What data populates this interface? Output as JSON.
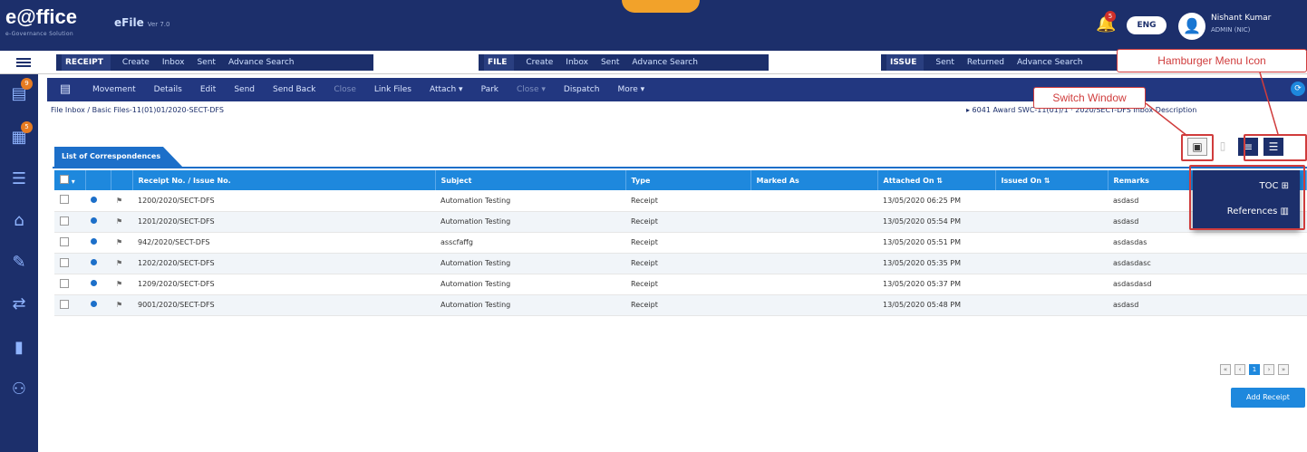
{
  "header": {
    "logo": "e@ffice",
    "logo_tag": "e-Governance Solution",
    "module": "eFile",
    "version": "Ver 7.0",
    "lang": "ENG",
    "user_name": "Nishant Kumar",
    "user_sub": "ADMIN (NIC)"
  },
  "nav": {
    "receipt": {
      "label": "RECEIPT",
      "items": [
        "Create",
        "Inbox",
        "Sent",
        "Advance Search"
      ]
    },
    "file": {
      "label": "FILE",
      "items": [
        "Create",
        "Inbox",
        "Sent",
        "Advance Search"
      ]
    },
    "issue": {
      "label": "ISSUE",
      "items": [
        "Sent",
        "Returned",
        "Advance Search"
      ]
    }
  },
  "toolbar": {
    "items": [
      {
        "label": "Movement",
        "enabled": true
      },
      {
        "label": "Details",
        "enabled": true
      },
      {
        "label": "Edit",
        "enabled": true
      },
      {
        "label": "Send",
        "enabled": true
      },
      {
        "label": "Send Back",
        "enabled": true
      },
      {
        "label": "Close",
        "enabled": false
      },
      {
        "label": "Link Files",
        "enabled": true
      },
      {
        "label": "Attach ▾",
        "enabled": true
      },
      {
        "label": "Park",
        "enabled": true
      },
      {
        "label": "Close ▾",
        "enabled": false
      },
      {
        "label": "Dispatch",
        "enabled": true
      },
      {
        "label": "More ▾",
        "enabled": true
      }
    ]
  },
  "breadcrumb": "File Inbox  /  Basic Files-11(01)01/2020-SECT-DFS",
  "file_info": "▸ 6041   Award SWC-11(01)/1  ·  2020/SECT-DFS    Inbox Description",
  "list_tab": "List of Correspondences",
  "table": {
    "headers": [
      "",
      "",
      "",
      "Receipt No. / Issue No.",
      "Subject",
      "Type",
      "Marked As",
      "Attached On ⇅",
      "Issued On ⇅",
      "Remarks"
    ],
    "rows": [
      {
        "no": "1200/2020/SECT-DFS",
        "subject": "Automation Testing",
        "type": "Receipt",
        "marked": "",
        "attached": "13/05/2020 06:25 PM",
        "issued": "",
        "remarks": "asdasd"
      },
      {
        "no": "1201/2020/SECT-DFS",
        "subject": "Automation Testing",
        "type": "Receipt",
        "marked": "",
        "attached": "13/05/2020 05:54 PM",
        "issued": "",
        "remarks": "asdasd"
      },
      {
        "no": "942/2020/SECT-DFS",
        "subject": "asscfaffg",
        "type": "Receipt",
        "marked": "",
        "attached": "13/05/2020 05:51 PM",
        "issued": "",
        "remarks": "asdasdas"
      },
      {
        "no": "1202/2020/SECT-DFS",
        "subject": "Automation Testing",
        "type": "Receipt",
        "marked": "",
        "attached": "13/05/2020 05:35 PM",
        "issued": "",
        "remarks": "asdasdasc"
      },
      {
        "no": "1209/2020/SECT-DFS",
        "subject": "Automation Testing",
        "type": "Receipt",
        "marked": "",
        "attached": "13/05/2020 05:37 PM",
        "issued": "",
        "remarks": "asdasdasd"
      },
      {
        "no": "9001/2020/SECT-DFS",
        "subject": "Automation Testing",
        "type": "Receipt",
        "marked": "",
        "attached": "13/05/2020 05:48 PM",
        "issued": "",
        "remarks": "asdasd"
      }
    ]
  },
  "dropdown": {
    "toc": "TOC ⊞",
    "references": "References ▥"
  },
  "pagination": {
    "current": "1"
  },
  "add_button": "Add Receipt",
  "callouts": {
    "switch_window": "Switch Window",
    "hamburger": "Hamburger Menu Icon"
  },
  "colors": {
    "primary": "#1c2f6b",
    "accent": "#1e88dd",
    "callout": "#d03c3c"
  }
}
